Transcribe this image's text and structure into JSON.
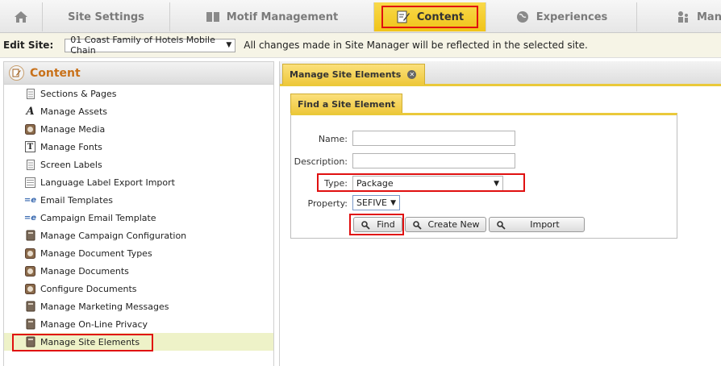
{
  "nav": {
    "tabs": [
      {
        "label": ""
      },
      {
        "label": "Site Settings"
      },
      {
        "label": "Motif Management"
      },
      {
        "label": "Content"
      },
      {
        "label": "Experiences"
      },
      {
        "label": "Mana"
      }
    ]
  },
  "edit_site": {
    "label": "Edit Site:",
    "selected": "01 Coast Family of Hotels Mobile Chain",
    "message": "All changes made in Site Manager will be reflected in the selected site."
  },
  "left": {
    "title": "Content",
    "items": [
      {
        "label": "Sections & Pages",
        "icon": "document-icon"
      },
      {
        "label": "Manage Assets",
        "icon": "font-a-icon"
      },
      {
        "label": "Manage Media",
        "icon": "media-icon"
      },
      {
        "label": "Manage Fonts",
        "icon": "font-t-icon"
      },
      {
        "label": "Screen Labels",
        "icon": "document-icon"
      },
      {
        "label": "Language Label Export Import",
        "icon": "document-lines-icon"
      },
      {
        "label": "Email Templates",
        "icon": "email-e-icon"
      },
      {
        "label": "Campaign Email Template",
        "icon": "email-e-icon"
      },
      {
        "label": "Manage Campaign Configuration",
        "icon": "box-icon"
      },
      {
        "label": "Manage Document Types",
        "icon": "media-icon"
      },
      {
        "label": "Manage Documents",
        "icon": "media-icon"
      },
      {
        "label": "Configure Documents",
        "icon": "media-icon"
      },
      {
        "label": "Manage Marketing Messages",
        "icon": "box-icon"
      },
      {
        "label": "Manage On-Line Privacy",
        "icon": "box-icon"
      },
      {
        "label": "Manage Site Elements",
        "icon": "box-icon"
      }
    ]
  },
  "right": {
    "tab_label": "Manage Site Elements",
    "section_title": "Find a Site Element",
    "form": {
      "name_label": "Name:",
      "name_value": "",
      "description_label": "Description:",
      "description_value": "",
      "type_label": "Type:",
      "type_value": "Package",
      "property_label": "Property:",
      "property_value": "SEFIVE"
    },
    "buttons": {
      "find": "Find",
      "create_new": "Create New",
      "import": "Import"
    }
  },
  "colors": {
    "accent_yellow": "#f0c419",
    "highlight_red": "#e01010",
    "content_title": "#c8711a"
  }
}
